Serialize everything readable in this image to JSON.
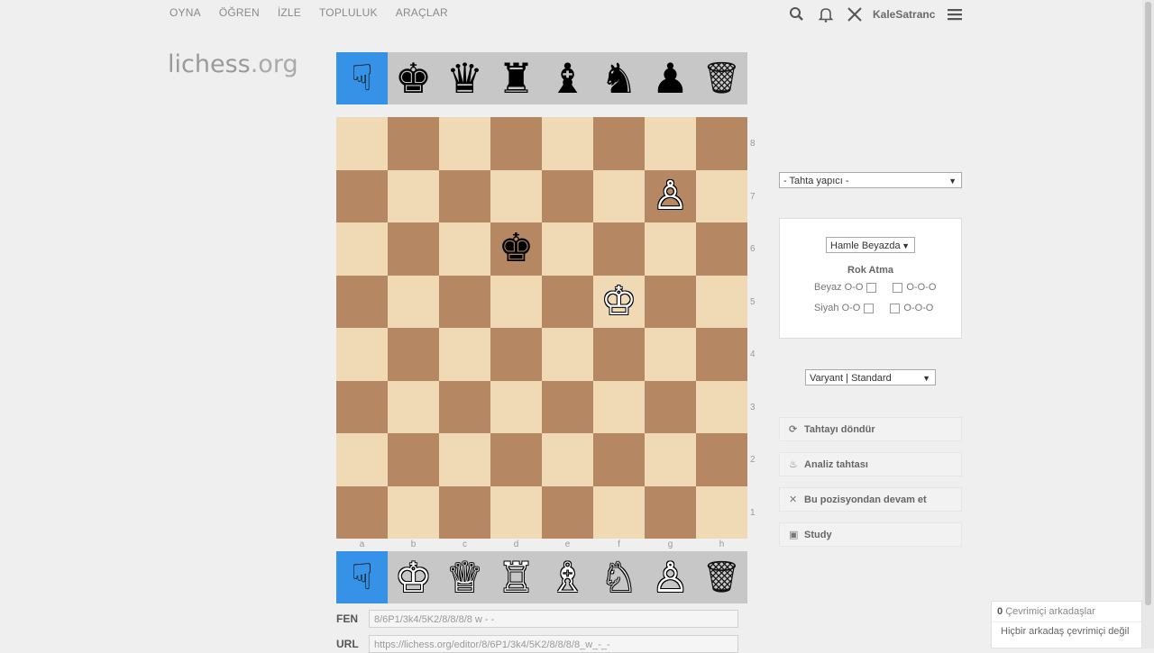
{
  "nav": {
    "items": [
      "OYNA",
      "ÖĞREN",
      "İZLE",
      "TOPLULUK",
      "ARAÇLAR"
    ]
  },
  "header": {
    "username": "KaleSatranc"
  },
  "logo": {
    "main": "lichess",
    "tld": ".org"
  },
  "spare_top": [
    "☟",
    "♚",
    "♛",
    "♜",
    "♝",
    "♞",
    "♟",
    "🗑"
  ],
  "spare_bottom": [
    "☟",
    "♔",
    "♕",
    "♖",
    "♗",
    "♘",
    "♙",
    "🗑"
  ],
  "board": {
    "ranks": [
      "8",
      "7",
      "6",
      "5",
      "4",
      "3",
      "2",
      "1"
    ],
    "files": [
      "a",
      "b",
      "c",
      "d",
      "e",
      "f",
      "g",
      "h"
    ],
    "pieces": [
      {
        "square": "g7",
        "glyph": "♙",
        "color": "w"
      },
      {
        "square": "d6",
        "glyph": "♚",
        "color": "b"
      },
      {
        "square": "f5",
        "glyph": "♔",
        "color": "w"
      }
    ]
  },
  "fen": {
    "label": "FEN",
    "value": "8/6P1/3k4/5K2/8/8/8/8 w - -"
  },
  "url": {
    "label": "URL",
    "value": "https://lichess.org/editor/8/6P1/3k4/5K2/8/8/8/8_w_-_-"
  },
  "side": {
    "board_builder": "- Tahta yapıcı -",
    "turn": "Hamle Beyazda",
    "castling_title": "Rok Atma",
    "white_label": "Beyaz O-O",
    "black_label": "Siyah O-O",
    "ooo": "O-O-O",
    "variant": "Varyant | Standard",
    "actions": [
      {
        "icon": "⟳",
        "label": "Tahtayı döndür"
      },
      {
        "icon": "♨",
        "label": "Analiz tahtası"
      },
      {
        "icon": "✕",
        "label": "Bu pozisyondan devam et"
      },
      {
        "icon": "▣",
        "label": "Study"
      }
    ]
  },
  "friends": {
    "count": "0",
    "title": "Çevrimiçi arkadaşlar",
    "empty": "Hiçbir arkadaş çevrimiçi değil"
  }
}
